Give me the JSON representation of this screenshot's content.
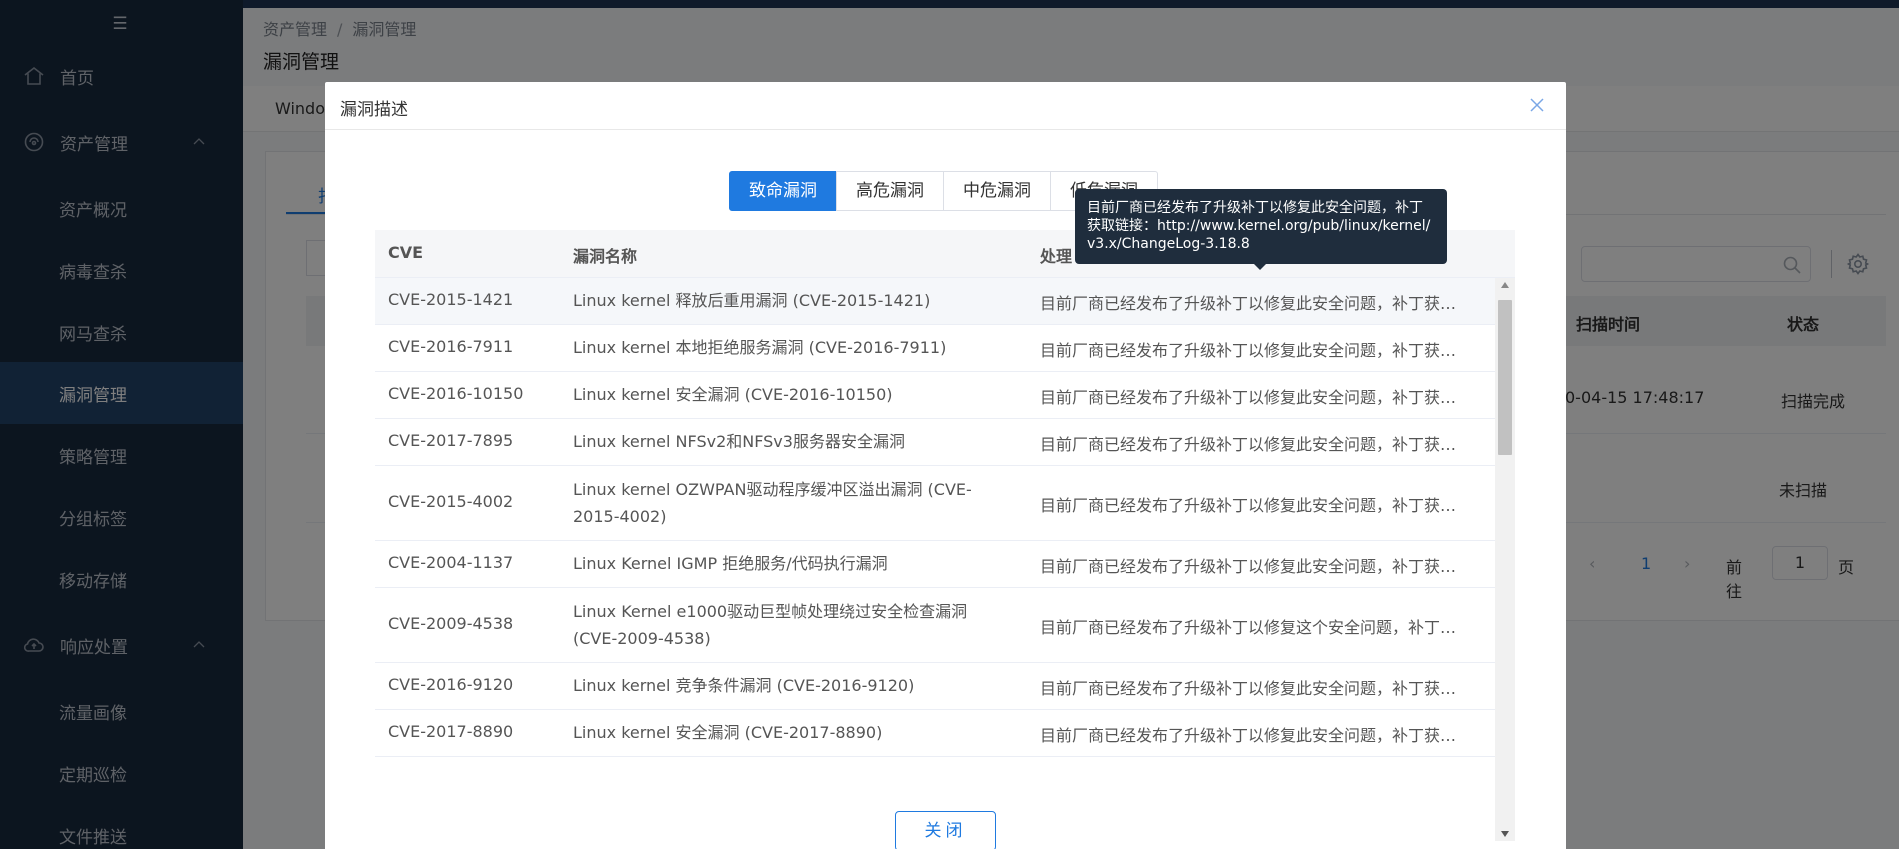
{
  "sidebar": {
    "items": [
      {
        "label": "首页"
      },
      {
        "label": "资产管理"
      },
      {
        "label": "资产概况"
      },
      {
        "label": "病毒查杀"
      },
      {
        "label": "网马查杀"
      },
      {
        "label": "漏洞管理"
      },
      {
        "label": "策略管理"
      },
      {
        "label": "分组标签"
      },
      {
        "label": "移动存储"
      },
      {
        "label": "响应处置"
      },
      {
        "label": "流量画像"
      },
      {
        "label": "定期巡检"
      },
      {
        "label": "文件推送"
      }
    ]
  },
  "main": {
    "breadcrumb": [
      "资产管理",
      "漏洞管理"
    ],
    "breadcrumb_sep": "/",
    "title": "漏洞管理",
    "tab_partial": "Windo",
    "subtab_partial": "扫",
    "search_placeholder": "",
    "table": {
      "col_time": "扫描时间",
      "col_status": "状态",
      "row1_time": "0-04-15 17:48:17",
      "row1_status": "扫描完成",
      "row2_status": "未扫描"
    },
    "pager": {
      "current": "1",
      "goto_label": "前往",
      "goto_value": "1",
      "page_label": "页"
    }
  },
  "dialog": {
    "title": "漏洞描述",
    "segments": [
      "致命漏洞",
      "高危漏洞",
      "中危漏洞",
      "低危漏洞"
    ],
    "columns": {
      "cve": "CVE",
      "name": "漏洞名称",
      "fix": "处理"
    },
    "rows": [
      {
        "cve": "CVE-2015-1421",
        "name": "Linux kernel 释放后重用漏洞 (CVE-2015-1421)",
        "fix": "目前厂商已经发布了升级补丁以修复此安全问题，补丁获取链接：http://www.kernel.org/pub/linux/kernel/v3.x/ChangeLog-3.18.8"
      },
      {
        "cve": "CVE-2016-7911",
        "name": "Linux kernel 本地拒绝服务漏洞 (CVE-2016-7911)",
        "fix": "目前厂商已经发布了升级补丁以修复此安全问题，补丁获取链接"
      },
      {
        "cve": "CVE-2016-10150",
        "name": "Linux kernel 安全漏洞 (CVE-2016-10150)",
        "fix": "目前厂商已经发布了升级补丁以修复此安全问题，补丁获取链接"
      },
      {
        "cve": "CVE-2017-7895",
        "name": "Linux kernel NFSv2和NFSv3服务器安全漏洞",
        "fix": "目前厂商已经发布了升级补丁以修复此安全问题，补丁获取链接"
      },
      {
        "cve": "CVE-2015-4002",
        "name": "Linux kernel OZWPAN驱动程序缓冲区溢出漏洞 (CVE-2015-4002)",
        "fix": "目前厂商已经发布了升级补丁以修复此安全问题，补丁获取链接"
      },
      {
        "cve": "CVE-2004-1137",
        "name": "Linux Kernel IGMP 拒绝服务/代码执行漏洞",
        "fix": "目前厂商已经发布了升级补丁以修复此安全问题，补丁获取链接"
      },
      {
        "cve": "CVE-2009-4538",
        "name": "Linux Kernel e1000驱动巨型帧处理绕过安全检查漏洞 (CVE-2009-4538)",
        "fix": "目前厂商已经发布了升级补丁以修复这个安全问题，补丁获取链接"
      },
      {
        "cve": "CVE-2016-9120",
        "name": "Linux kernel 竞争条件漏洞 (CVE-2016-9120)",
        "fix": "目前厂商已经发布了升级补丁以修复此安全问题，补丁获取链接"
      },
      {
        "cve": "CVE-2017-8890",
        "name": "Linux kernel 安全漏洞 (CVE-2017-8890)",
        "fix": "目前厂商已经发布了升级补丁以修复此安全问题，补丁获取链接"
      }
    ],
    "tooltip": "目前厂商已经发布了升级补丁以修复此安全问题，补丁获取链接：http://www.kernel.org/pub/linux/kernel/v3.x/ChangeLog-3.18.8",
    "close_button": "关闭"
  },
  "colors": {
    "sidebar_bg": "#192a3f",
    "sidebar_active": "#23446b",
    "accent": "#1f7ae0",
    "tooltip_bg": "#1f2d3d"
  }
}
